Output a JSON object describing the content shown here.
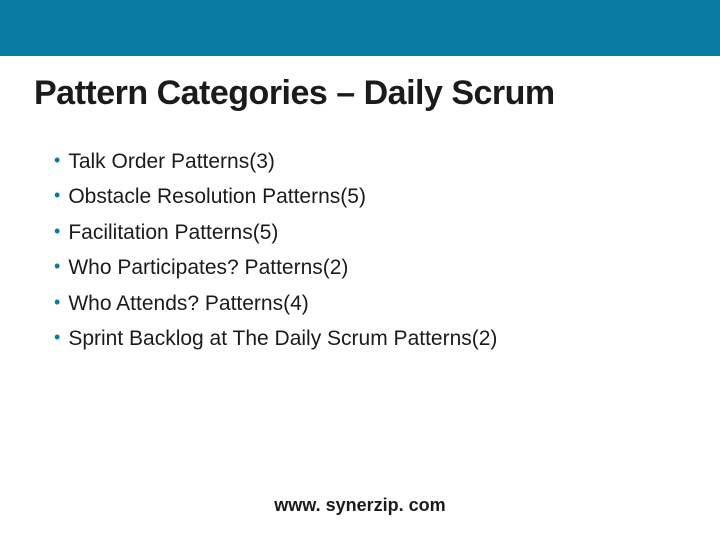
{
  "title": "Pattern Categories – Daily Scrum",
  "bullets": [
    "Talk Order Patterns(3)",
    "Obstacle Resolution Patterns(5)",
    "Facilitation Patterns(5)",
    "Who Participates? Patterns(2)",
    "Who Attends? Patterns(4)",
    "Sprint Backlog at The Daily Scrum Patterns(2)"
  ],
  "footer": "www. synerzip. com"
}
